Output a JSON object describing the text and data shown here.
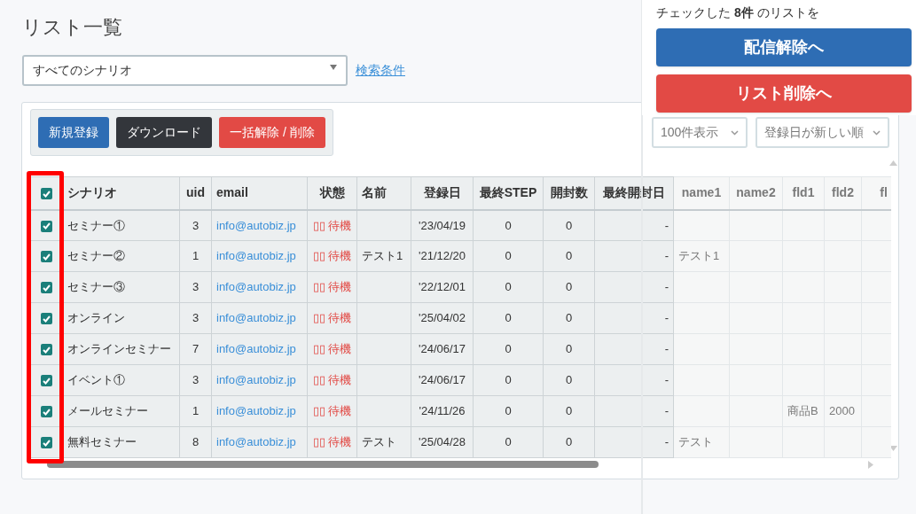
{
  "title": "リスト一覧",
  "scenario_select": {
    "value": "すべてのシナリオ"
  },
  "search_link": "検索条件",
  "toolbar": [
    {
      "label": "新規登録",
      "kind": "primary"
    },
    {
      "label": "ダウンロード",
      "kind": "dark"
    },
    {
      "label": "一括解除 / 削除",
      "kind": "danger"
    }
  ],
  "page_size_select": {
    "value": "100件表示"
  },
  "sort_select": {
    "value": "登録日が新しい順"
  },
  "table": {
    "all_checked": true,
    "columns": [
      {
        "label": "シナリオ"
      },
      {
        "label": "uid"
      },
      {
        "label": "email"
      },
      {
        "label": "状態"
      },
      {
        "label": "名前"
      },
      {
        "label": "登録日"
      },
      {
        "label": "最終STEP"
      },
      {
        "label": "開封数"
      },
      {
        "label": "最終開封日"
      },
      {
        "label": "name1"
      },
      {
        "label": "name2"
      },
      {
        "label": "fld1"
      },
      {
        "label": "fld2"
      },
      {
        "label": "fl"
      }
    ],
    "rows": [
      {
        "checked": true,
        "scenario": "セミナー①",
        "uid": "3",
        "email": "info@autobiz.jp",
        "status": "▯▯ 待機",
        "registered": "'23/04/19",
        "last_step": "0",
        "opens": "0",
        "last_open": "-"
      },
      {
        "checked": true,
        "scenario": "セミナー②",
        "uid": "1",
        "email": "info@autobiz.jp",
        "status": "▯▯ 待機",
        "name": "テスト1",
        "registered": "'21/12/20",
        "last_step": "0",
        "opens": "0",
        "last_open": "-",
        "name1": "テスト1"
      },
      {
        "checked": true,
        "scenario": "セミナー③",
        "uid": "3",
        "email": "info@autobiz.jp",
        "status": "▯▯ 待機",
        "registered": "'22/12/01",
        "last_step": "0",
        "opens": "0",
        "last_open": "-"
      },
      {
        "checked": true,
        "scenario": "オンライン",
        "uid": "3",
        "email": "info@autobiz.jp",
        "status": "▯▯ 待機",
        "registered": "'25/04/02",
        "last_step": "0",
        "opens": "0",
        "last_open": "-"
      },
      {
        "checked": true,
        "scenario": "オンラインセミナー",
        "uid": "7",
        "email": "info@autobiz.jp",
        "status": "▯▯ 待機",
        "registered": "'24/06/17",
        "last_step": "0",
        "opens": "0",
        "last_open": "-"
      },
      {
        "checked": true,
        "scenario": "イベント①",
        "uid": "3",
        "email": "info@autobiz.jp",
        "status": "▯▯ 待機",
        "registered": "'24/06/17",
        "last_step": "0",
        "opens": "0",
        "last_open": "-"
      },
      {
        "checked": true,
        "scenario": "メールセミナー",
        "uid": "1",
        "email": "info@autobiz.jp",
        "status": "▯▯ 待機",
        "registered": "'24/11/26",
        "last_step": "0",
        "opens": "0",
        "last_open": "-",
        "fld1": "商品B",
        "fld2": "2000"
      },
      {
        "checked": true,
        "scenario": "無料セミナー",
        "uid": "8",
        "email": "info@autobiz.jp",
        "status": "▯▯ 待機",
        "name": "テスト",
        "registered": "'25/04/28",
        "last_step": "0",
        "opens": "0",
        "last_open": "-",
        "name1": "テスト"
      }
    ]
  },
  "action_panel": {
    "message": "チェックした **8件** のリストを",
    "buttons": [
      {
        "label": "配信解除へ",
        "kind": "primary"
      },
      {
        "label": "リスト削除へ",
        "kind": "danger"
      }
    ]
  }
}
